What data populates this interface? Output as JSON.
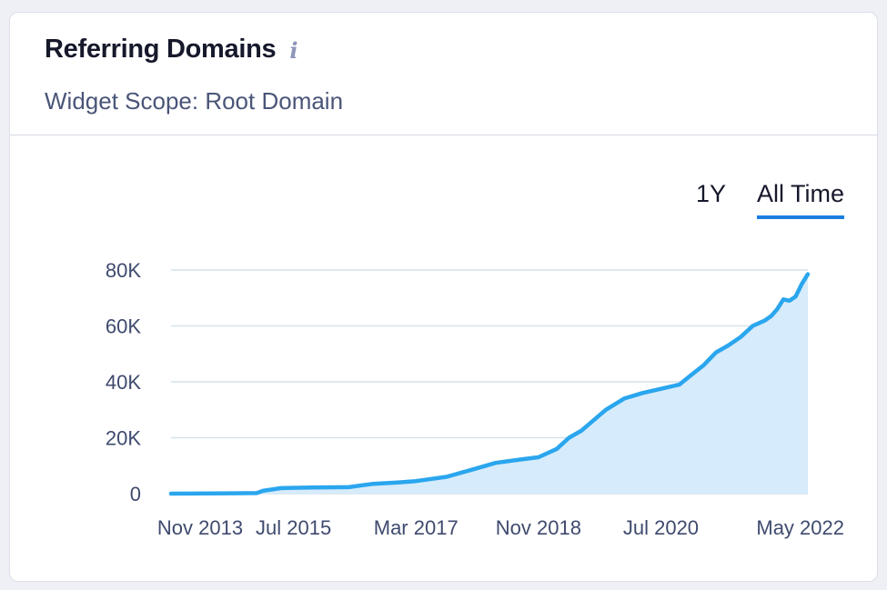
{
  "widget": {
    "title": "Referring Domains",
    "info_icon": "i",
    "subtitle": "Widget Scope: Root Domain"
  },
  "range_tabs": [
    {
      "label": "1Y",
      "active": false
    },
    {
      "label": "All Time",
      "active": true
    }
  ],
  "colors": {
    "line": "#2aa6ee",
    "area": "#d6ebfb",
    "grid": "#d3e2ec",
    "active_tab": "#1a7ee0"
  },
  "chart_data": {
    "type": "area",
    "title": "",
    "xlabel": "",
    "ylabel": "",
    "ylim": [
      0,
      80000
    ],
    "yticks": [
      {
        "value": 0,
        "label": "0"
      },
      {
        "value": 20000,
        "label": "20K"
      },
      {
        "value": 40000,
        "label": "40K"
      },
      {
        "value": 60000,
        "label": "60K"
      },
      {
        "value": 80000,
        "label": "80K"
      }
    ],
    "xlim": [
      "2013-11",
      "2022-07"
    ],
    "xticks": [
      {
        "value": "2013-11",
        "label": "Nov 2013"
      },
      {
        "value": "2015-07",
        "label": "Jul 2015"
      },
      {
        "value": "2017-03",
        "label": "Mar 2017"
      },
      {
        "value": "2018-11",
        "label": "Nov 2018"
      },
      {
        "value": "2020-07",
        "label": "Jul 2020"
      },
      {
        "value": "2022-05",
        "label": "May 2022"
      }
    ],
    "grid": true,
    "series": [
      {
        "points": [
          {
            "x": "2013-11",
            "y": 0
          },
          {
            "x": "2014-06",
            "y": 100
          },
          {
            "x": "2015-01",
            "y": 200
          },
          {
            "x": "2015-02",
            "y": 1000
          },
          {
            "x": "2015-05",
            "y": 2000
          },
          {
            "x": "2015-10",
            "y": 2200
          },
          {
            "x": "2016-04",
            "y": 2300
          },
          {
            "x": "2016-08",
            "y": 3500
          },
          {
            "x": "2016-12",
            "y": 4000
          },
          {
            "x": "2017-03",
            "y": 4500
          },
          {
            "x": "2017-08",
            "y": 6000
          },
          {
            "x": "2017-12",
            "y": 8500
          },
          {
            "x": "2018-04",
            "y": 11000
          },
          {
            "x": "2018-08",
            "y": 12200
          },
          {
            "x": "2018-11",
            "y": 13000
          },
          {
            "x": "2019-02",
            "y": 16000
          },
          {
            "x": "2019-04",
            "y": 20000
          },
          {
            "x": "2019-06",
            "y": 22500
          },
          {
            "x": "2019-10",
            "y": 30000
          },
          {
            "x": "2020-01",
            "y": 34000
          },
          {
            "x": "2020-04",
            "y": 36000
          },
          {
            "x": "2020-07",
            "y": 37500
          },
          {
            "x": "2020-10",
            "y": 39000
          },
          {
            "x": "2020-12",
            "y": 42500
          },
          {
            "x": "2021-02",
            "y": 46000
          },
          {
            "x": "2021-04",
            "y": 50500
          },
          {
            "x": "2021-06",
            "y": 53000
          },
          {
            "x": "2021-08",
            "y": 56000
          },
          {
            "x": "2021-10",
            "y": 60000
          },
          {
            "x": "2021-12",
            "y": 62000
          },
          {
            "x": "2022-01",
            "y": 63500
          },
          {
            "x": "2022-02",
            "y": 66000
          },
          {
            "x": "2022-03",
            "y": 69500
          },
          {
            "x": "2022-04",
            "y": 69000
          },
          {
            "x": "2022-05",
            "y": 70500
          },
          {
            "x": "2022-06",
            "y": 75000
          },
          {
            "x": "2022-07",
            "y": 78500
          }
        ]
      }
    ]
  }
}
